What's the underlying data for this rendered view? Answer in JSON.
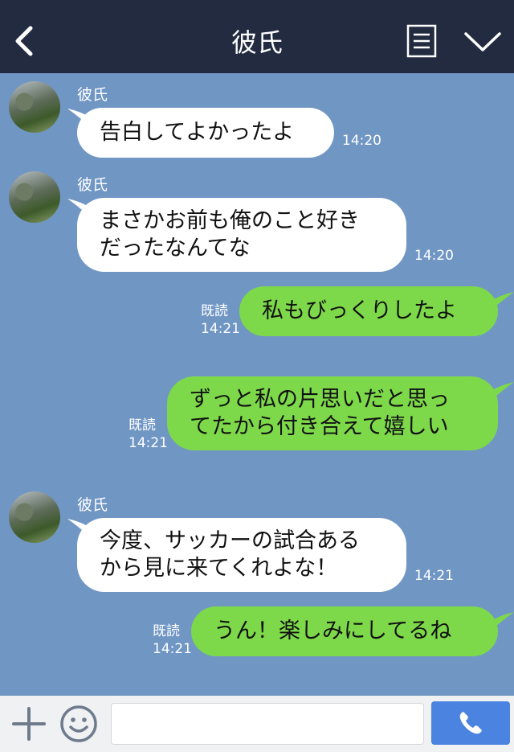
{
  "header": {
    "title": "彼氏",
    "back_icon": "chevron-left-icon",
    "menu_icon": "menu-lines-icon",
    "expand_icon": "chevron-down-icon"
  },
  "messages": [
    {
      "type": "in",
      "sender": "彼氏",
      "text": "告白してよかったよ",
      "time": "14:20"
    },
    {
      "type": "in",
      "sender": "彼氏",
      "text": "まさかお前も俺のこと好き\nだったなんてな",
      "time": "14:20"
    },
    {
      "type": "out",
      "read": "既読",
      "text": "私もびっくりしたよ",
      "time": "14:21"
    },
    {
      "type": "out",
      "read": "既読",
      "text": "ずっと私の片思いだと思っ\nてたから付き合えて嬉しい",
      "time": "14:21"
    },
    {
      "type": "in",
      "sender": "彼氏",
      "text": "今度、サッカーの試合ある\nから見に来てくれよな！",
      "time": "14:21"
    },
    {
      "type": "out",
      "read": "既読",
      "text": "うん！楽しみにしてるね",
      "time": "14:21"
    }
  ],
  "footer": {
    "plus_icon": "plus-icon",
    "emoji_icon": "smiley-icon",
    "input_value": "",
    "call_icon": "phone-icon"
  },
  "colors": {
    "background": "#7096c4",
    "header": "#232b40",
    "incoming_bubble": "#ffffff",
    "outgoing_bubble": "#7ed94a",
    "call_button": "#4a84e0"
  }
}
